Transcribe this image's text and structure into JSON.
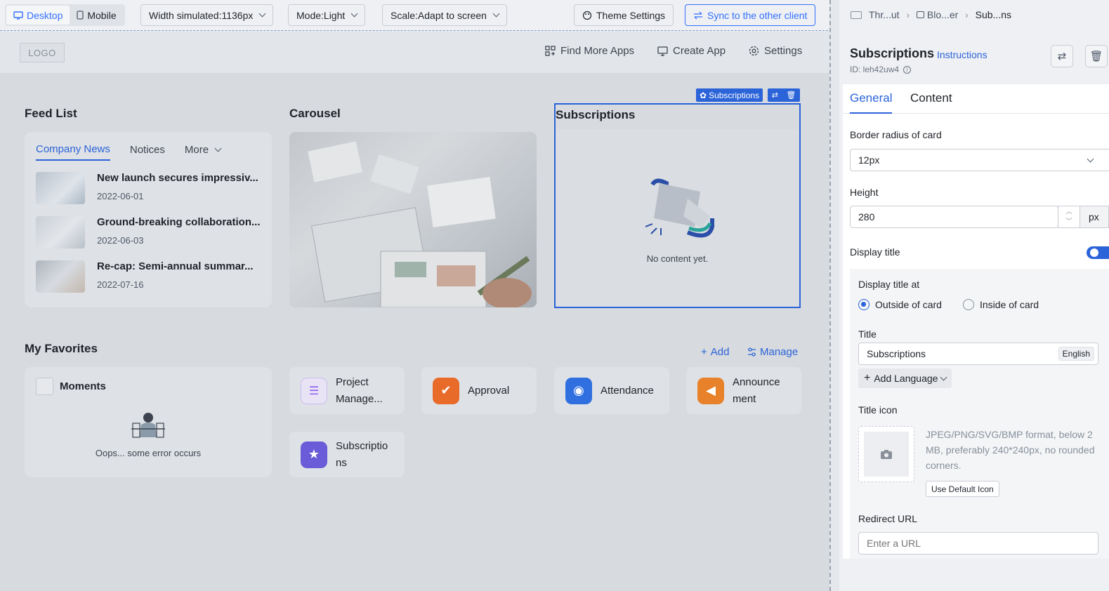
{
  "toolbar": {
    "desktop_label": "Desktop",
    "mobile_label": "Mobile",
    "width_label": "Width simulated:1136px",
    "mode_label": "Mode:Light",
    "scale_label": "Scale:Adapt to screen",
    "theme_label": "Theme Settings",
    "sync_label": "Sync to the other client"
  },
  "app": {
    "logo": "LOGO",
    "nav": [
      "Find More Apps",
      "Create App",
      "Settings"
    ]
  },
  "feed": {
    "title": "Feed List",
    "tabs": [
      "Company News",
      "Notices",
      "More"
    ],
    "items": [
      {
        "title": "New launch secures impressiv...",
        "date": "2022-06-01"
      },
      {
        "title": "Ground-breaking collaboration...",
        "date": "2022-06-03"
      },
      {
        "title": "Re-cap: Semi-annual summar...",
        "date": "2022-07-16"
      }
    ]
  },
  "carousel": {
    "title": "Carousel"
  },
  "subscriptions": {
    "badge": "Subscriptions",
    "title": "Subscriptions",
    "empty": "No content yet."
  },
  "favorites": {
    "title": "My Favorites",
    "add": "Add",
    "manage": "Manage",
    "moments_title": "Moments",
    "moments_error": "Oops... some error occurs",
    "apps": [
      {
        "label_line1": "Project",
        "label_line2": "Manage...",
        "color": "#8e5ff0"
      },
      {
        "label_line1": "Approval",
        "label_line2": "",
        "color": "#e86b2a"
      },
      {
        "label_line1": "Attendance",
        "label_line2": "",
        "color": "#2f6fe0"
      },
      {
        "label_line1": "Announce",
        "label_line2": "ment",
        "color": "#e8822a"
      },
      {
        "label_line1": "Subscriptio",
        "label_line2": "ns",
        "color": "#6a5cd8"
      }
    ]
  },
  "panel": {
    "breadcrumbs": [
      "Thr...ut",
      "Blo...er",
      "Sub...ns"
    ],
    "title": "Subscriptions",
    "instructions": "Instructions",
    "id": "ID:  leh42uw4",
    "tabs": [
      "General",
      "Content"
    ],
    "border_radius_label": "Border radius of card",
    "border_radius_value": "12px",
    "height_label": "Height",
    "height_value": "280",
    "height_unit": "px",
    "display_title_label": "Display title",
    "display_title_at_label": "Display title at",
    "outside_label": "Outside of card",
    "inside_label": "Inside of card",
    "title_label": "Title",
    "title_value": "Subscriptions",
    "lang_tag": "English",
    "add_language": "Add Language",
    "title_icon_label": "Title icon",
    "icon_hint": "JPEG/PNG/SVG/BMP format, below 2 MB, preferably 240*240px, no rounded corners.",
    "use_default_icon": "Use Default Icon",
    "redirect_label": "Redirect URL",
    "redirect_placeholder": "Enter a URL"
  }
}
